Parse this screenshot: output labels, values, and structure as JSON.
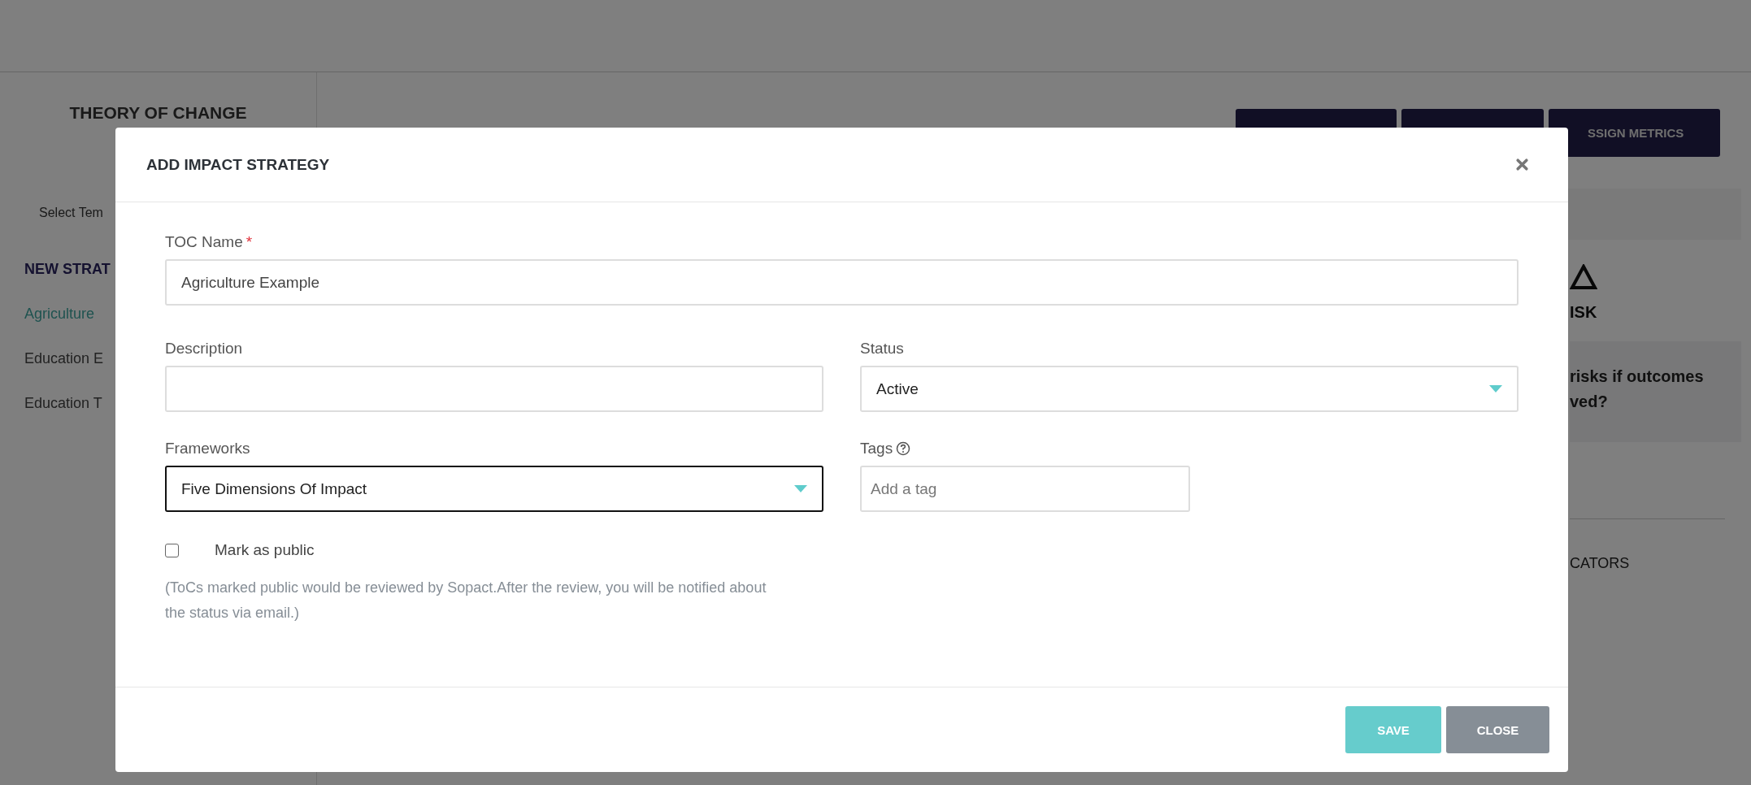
{
  "page": {
    "sidebar": {
      "title": "THEORY OF CHANGE",
      "template_label": "Select Tem",
      "section": "NEW STRAT",
      "items": [
        {
          "label": "Agriculture",
          "selected": true
        },
        {
          "label": "Education E",
          "selected": false
        },
        {
          "label": "Education T",
          "selected": false
        }
      ]
    },
    "toolbar": {
      "visible_label": "SSIGN METRICS"
    },
    "right_panel": {
      "risk_label": "ISK",
      "question_lines": [
        "risks if outcomes",
        "ved?"
      ],
      "indicators_label": "CATORS"
    }
  },
  "modal": {
    "title": "ADD IMPACT STRATEGY",
    "toc_name": {
      "label": "TOC Name",
      "required": true,
      "required_mark": "*",
      "value": "Agriculture Example"
    },
    "description": {
      "label": "Description"
    },
    "status": {
      "label": "Status",
      "value": "Active"
    },
    "frameworks": {
      "label": "Frameworks",
      "value": "Five Dimensions Of Impact",
      "focused": true
    },
    "tags": {
      "label": "Tags",
      "placeholder": "Add a tag"
    },
    "mark_public": {
      "label": "Mark as public",
      "checked": false
    },
    "note": "(ToCs marked public would be reviewed by Sopact.After the review, you will be notified about the status via email.)",
    "buttons": [
      {
        "label": "SAVE",
        "kind": "primary"
      },
      {
        "label": "CLOSE",
        "kind": "secondary"
      }
    ]
  }
}
